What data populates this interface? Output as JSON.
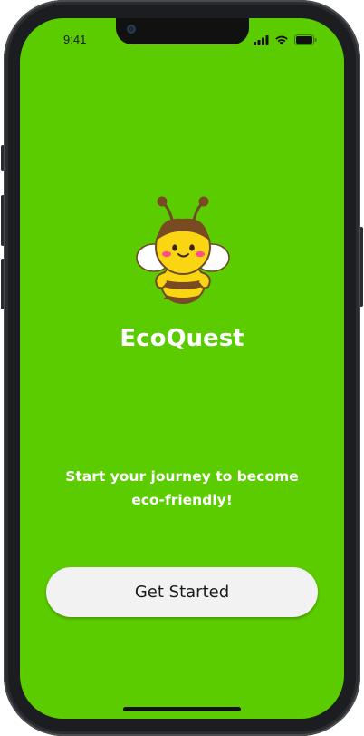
{
  "status_bar": {
    "time": "9:41"
  },
  "app": {
    "name": "EcoQuest",
    "tagline": "Start your journey to become eco-friendly!",
    "cta_label": "Get Started"
  },
  "colors": {
    "background": "#5bcc00",
    "button_background": "#f2f2f2",
    "text_on_green": "#ffffff",
    "bee_body": "#f9d512",
    "bee_stripe": "#7a4a22"
  },
  "icons": {
    "mascot": "bee-mascot-icon",
    "signal": "cellular-signal-icon",
    "wifi": "wifi-icon",
    "battery": "battery-icon"
  }
}
